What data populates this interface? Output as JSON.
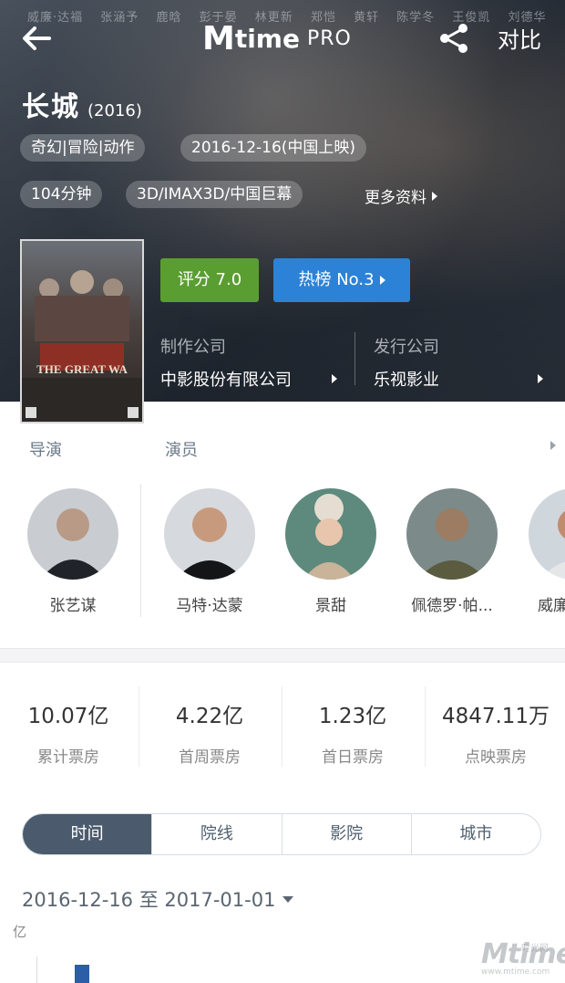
{
  "header": {
    "credits_strip": [
      "威廉·达福",
      "张涵予",
      "鹿晗",
      "彭于晏",
      "林更新",
      "郑恺",
      "黄轩",
      "陈学冬",
      "王俊凯",
      "刘德华"
    ],
    "logo_main": "time",
    "logo_pro": "PRO",
    "compare_label": "对比"
  },
  "movie": {
    "title": "长城",
    "year": "(2016)",
    "genre": "奇幻|冒险|动作",
    "release": "2016-12-16(中国上映)",
    "duration": "104分钟",
    "formats": "3D/IMAX3D/中国巨幕",
    "more_label": "更多资料",
    "score_label": "评分 7.0",
    "rank_label": "热榜 No.3",
    "production_label": "制作公司",
    "production_value": "中影股份有限公司",
    "distribution_label": "发行公司",
    "distribution_value": "乐视影业"
  },
  "poster": {
    "title": "THE GREAT WA"
  },
  "crew": {
    "director_label": "导演",
    "actor_label": "演员",
    "people": [
      {
        "name": "张艺谋",
        "icon": "avatar-director"
      },
      {
        "name": "马特·达蒙",
        "icon": "avatar-actor"
      },
      {
        "name": "景甜",
        "icon": "avatar-actor"
      },
      {
        "name": "佩德罗·帕...",
        "icon": "avatar-actor"
      },
      {
        "name": "威廉",
        "icon": "avatar-actor"
      }
    ]
  },
  "box_office": [
    {
      "value": "10.07亿",
      "label": "累计票房"
    },
    {
      "value": "4.22亿",
      "label": "首周票房"
    },
    {
      "value": "1.23亿",
      "label": "首日票房"
    },
    {
      "value": "4847.11万",
      "label": "点映票房"
    }
  ],
  "tabs": [
    "时间",
    "院线",
    "影院",
    "城市"
  ],
  "active_tab": "时间",
  "date_range": "2016-12-16 至 2017-01-01",
  "chart_unit": "亿",
  "watermark": {
    "logo": "Mtime",
    "cn": "时光网",
    "url": "www.mtime.com"
  },
  "colors": {
    "score": "#5a9e32",
    "rank": "#2c82d6",
    "active_tab": "#4b5b6d",
    "bar": "#2c5ea8"
  }
}
